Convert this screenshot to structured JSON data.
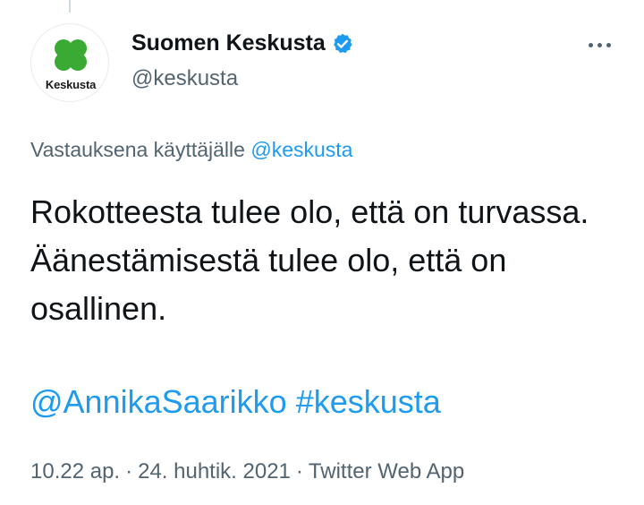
{
  "author": {
    "display_name": "Suomen Keskusta",
    "handle": "@keskusta",
    "avatar_text": "Keskusta",
    "verified": true
  },
  "reply_context": {
    "prefix": "Vastauksena käyttäjälle",
    "mention": "@keskusta"
  },
  "tweet": {
    "text": "Rokotteesta tulee olo, että on turvassa. Äänestämisestä tulee olo, että on osallinen.",
    "mention": "@AnnikaSaarikko",
    "hashtag": "#keskusta"
  },
  "meta": {
    "time": "10.22 ap.",
    "date": "24. huhtik. 2021",
    "source": "Twitter Web App",
    "separator": "·"
  },
  "colors": {
    "accent": "#1d9bf0",
    "secondary_text": "#536471",
    "logo_green": "#3aaa35"
  },
  "icons": {
    "verified": "verified-badge-icon",
    "more": "more-options-icon",
    "logo": "clover-logo-icon"
  }
}
